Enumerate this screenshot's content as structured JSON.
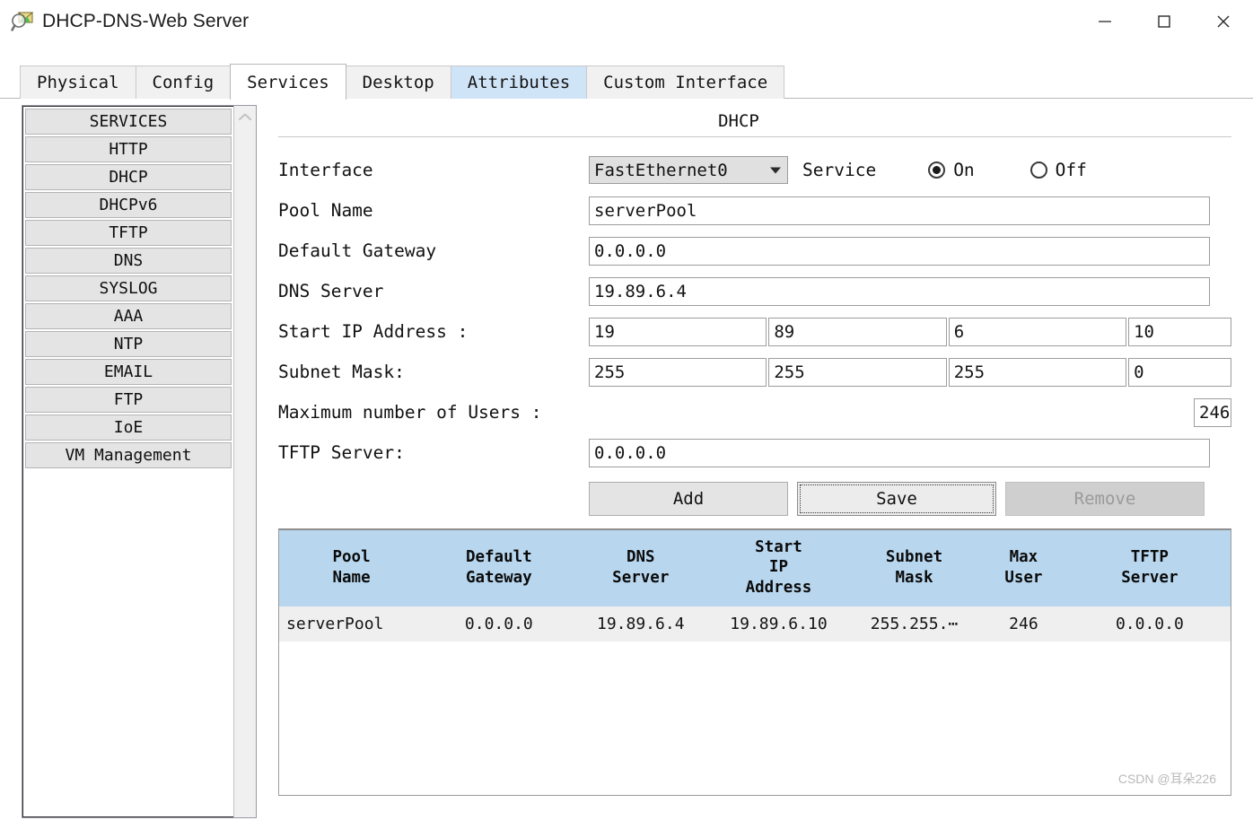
{
  "window": {
    "title": "DHCP-DNS-Web Server",
    "icon": "packet-tracer-icon",
    "minimize_label": "—",
    "maximize_label": "□",
    "close_label": "✕"
  },
  "tabs": [
    {
      "label": "Physical",
      "state": "normal"
    },
    {
      "label": "Config",
      "state": "normal"
    },
    {
      "label": "Services",
      "state": "active"
    },
    {
      "label": "Desktop",
      "state": "normal"
    },
    {
      "label": "Attributes",
      "state": "hovered"
    },
    {
      "label": "Custom Interface",
      "state": "normal"
    }
  ],
  "sidebar": {
    "items": [
      {
        "label": "SERVICES"
      },
      {
        "label": "HTTP"
      },
      {
        "label": "DHCP"
      },
      {
        "label": "DHCPv6"
      },
      {
        "label": "TFTP"
      },
      {
        "label": "DNS"
      },
      {
        "label": "SYSLOG"
      },
      {
        "label": "AAA"
      },
      {
        "label": "NTP"
      },
      {
        "label": "EMAIL"
      },
      {
        "label": "FTP"
      },
      {
        "label": "IoE"
      },
      {
        "label": "VM Management"
      }
    ],
    "scroll_up_icon": "chevron-up-icon"
  },
  "panel": {
    "title": "DHCP",
    "interface": {
      "label": "Interface",
      "value": "FastEthernet0",
      "caret_icon": "chevron-down-icon"
    },
    "service": {
      "label": "Service",
      "on_label": "On",
      "off_label": "Off",
      "selected": "On"
    },
    "pool_name": {
      "label": "Pool Name",
      "value": "serverPool"
    },
    "default_gateway": {
      "label": "Default Gateway",
      "value": "0.0.0.0"
    },
    "dns_server": {
      "label": "DNS Server",
      "value": "19.89.6.4"
    },
    "start_ip": {
      "label": "Start IP Address :",
      "octets": [
        "19",
        "89",
        "6",
        "10"
      ]
    },
    "subnet_mask": {
      "label": "Subnet Mask:",
      "octets": [
        "255",
        "255",
        "255",
        "0"
      ]
    },
    "max_users": {
      "label": "Maximum number of Users :",
      "value": "246"
    },
    "tftp_server": {
      "label": "TFTP Server:",
      "value": "0.0.0.0"
    },
    "buttons": {
      "add": "Add",
      "save": "Save",
      "remove": "Remove"
    }
  },
  "table": {
    "columns": [
      "Pool\nName",
      "Default\nGateway",
      "DNS\nServer",
      "Start\nIP\nAddress",
      "Subnet\nMask",
      "Max\nUser",
      "TFTP\nServer"
    ],
    "rows": [
      {
        "pool_name": "serverPool",
        "default_gateway": "0.0.0.0",
        "dns_server": "19.89.6.4",
        "start_ip_address": "19.89.6.10",
        "subnet_mask": "255.255.⋯",
        "max_user": "246",
        "tftp_server": "0.0.0.0"
      }
    ]
  },
  "watermark": "CSDN @耳朵226",
  "colors": {
    "tab_hover": "#cfe4f7",
    "table_header": "#b8d7ef",
    "table_row": "#efefef",
    "button_face": "#e4e4e4"
  }
}
